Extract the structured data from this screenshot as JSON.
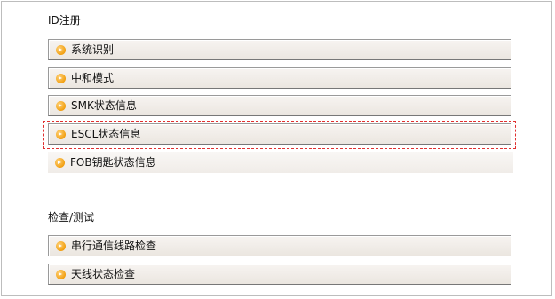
{
  "sections": [
    {
      "title": "ID注册",
      "items": [
        {
          "label": "系统识别"
        },
        {
          "label": "中和模式"
        },
        {
          "label": "SMK状态信息"
        },
        {
          "label": "ESCL状态信息"
        },
        {
          "label": "FOB钥匙状态信息"
        }
      ]
    },
    {
      "title": "检查/测试",
      "items": [
        {
          "label": "串行通信线路检查"
        },
        {
          "label": "天线状态检查"
        }
      ]
    }
  ]
}
